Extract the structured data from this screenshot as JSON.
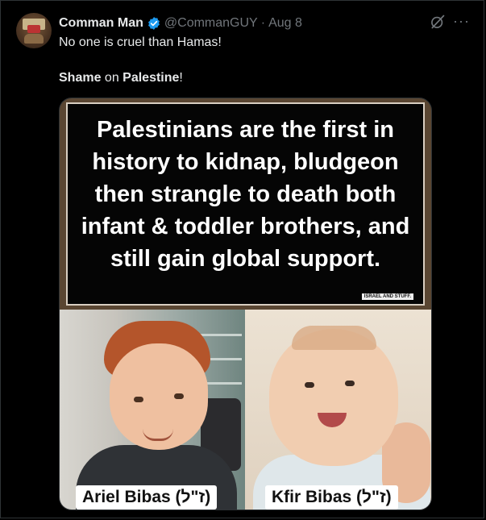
{
  "post": {
    "author_name": "Comman Man",
    "handle": "@CommanGUY",
    "separator": "·",
    "date": "Aug 8",
    "text_line1": "No one is cruel than Hamas!",
    "text_line2": {
      "part1": "Shame",
      "part2": " on ",
      "part3": "Palestine",
      "part4": "!"
    },
    "more_glyph": "···"
  },
  "media": {
    "headline": "Palestinians are the first in history to kidnap, bludgeon then strangle to death both infant & toddler brothers, and still gain global support.",
    "watermark": "ISRAEL AND STUFF.",
    "caption_left": "Ariel Bibas (ז\"ל)",
    "caption_right": "Kfir Bibas (ז\"ל)"
  },
  "colors": {
    "background": "#000000",
    "text": "#e7e9ea",
    "muted": "#71767b",
    "verified": "#1d9bf0"
  },
  "icons": {
    "verified": "verified-badge-icon",
    "grok": "grok-icon",
    "more": "more-options-icon"
  }
}
